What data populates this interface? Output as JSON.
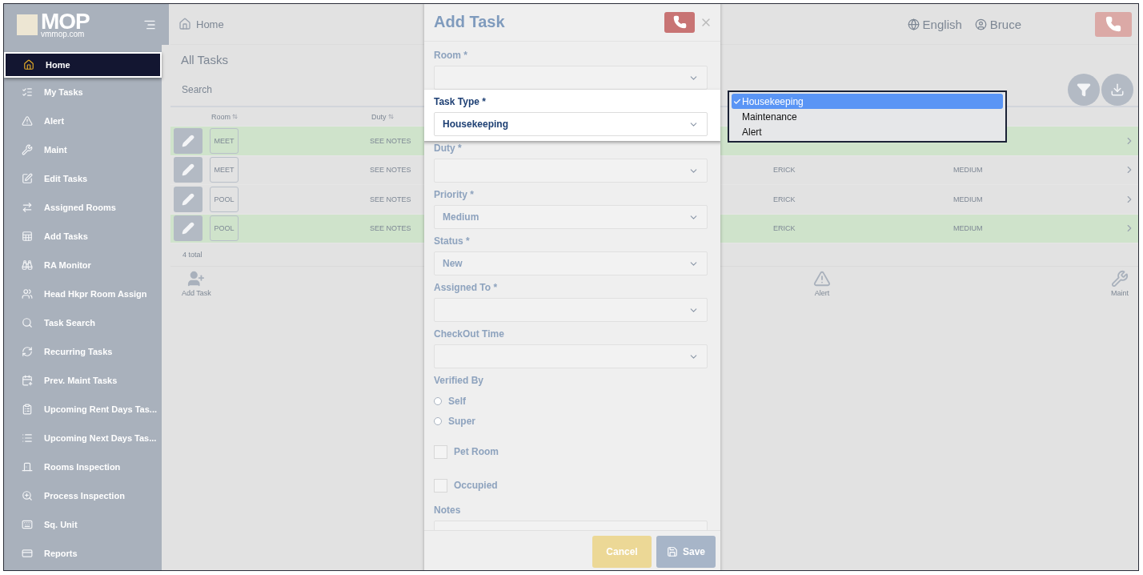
{
  "sidebar": {
    "logo": {
      "name": "MOP",
      "site": "vmmop.com"
    },
    "items": [
      {
        "label": "Home",
        "selected": true
      },
      {
        "label": "My Tasks",
        "selected": false
      },
      {
        "label": "Alert",
        "selected": false
      },
      {
        "label": "Maint",
        "selected": false
      },
      {
        "label": "Edit Tasks",
        "selected": false
      },
      {
        "label": "Assigned Rooms",
        "selected": false
      },
      {
        "label": "Add Tasks",
        "selected": false
      },
      {
        "label": "RA Monitor",
        "selected": false
      },
      {
        "label": "Head Hkpr Room Assign",
        "selected": false
      },
      {
        "label": "Task Search",
        "selected": false
      },
      {
        "label": "Recurring Tasks",
        "selected": false
      },
      {
        "label": "Prev. Maint Tasks",
        "selected": false
      },
      {
        "label": "Upcoming Rent Days Tas...",
        "selected": false
      },
      {
        "label": "Upcoming Next Days Tas...",
        "selected": false
      },
      {
        "label": "Rooms Inspection",
        "selected": false
      },
      {
        "label": "Process Inspection",
        "selected": false
      },
      {
        "label": "Sq. Unit",
        "selected": false
      },
      {
        "label": "Reports",
        "selected": false
      }
    ]
  },
  "header": {
    "breadcrumb": "Home",
    "language": "English",
    "user": "Bruce"
  },
  "page": {
    "title": "All Tasks",
    "search": {
      "placeholder": "Search"
    },
    "table": {
      "columns": [
        "Room",
        "Duty"
      ],
      "rows": [
        {
          "room": "MEET",
          "duty": "SEE NOTES",
          "highlighted": true
        },
        {
          "room": "MEET",
          "duty": "SEE NOTES",
          "assignee": "ERICK",
          "priority": "MEDIUM",
          "highlighted": false
        },
        {
          "room": "POOL",
          "duty": "SEE NOTES",
          "assignee": "ERICK",
          "priority": "MEDIUM",
          "highlighted": false
        },
        {
          "room": "POOL",
          "duty": "SEE NOTES",
          "assignee": "ERICK",
          "priority": "MEDIUM",
          "highlighted": true
        }
      ],
      "footer": "4 total"
    },
    "actions": [
      {
        "label": "Add Task"
      },
      {
        "label": "Alert"
      },
      {
        "label": "Maint"
      }
    ]
  },
  "modal": {
    "title": "Add Task",
    "fields": [
      {
        "kind": "select",
        "label": "Room *",
        "highlighted": false
      },
      {
        "kind": "select",
        "label": "Task Type *",
        "value": "Housekeeping",
        "highlighted": true
      },
      {
        "kind": "select",
        "label": "Duty *",
        "highlighted": false
      },
      {
        "kind": "select",
        "label": "Priority *",
        "value": "Medium",
        "highlighted": false
      },
      {
        "kind": "select",
        "label": "Status *",
        "value": "New",
        "highlighted": false
      },
      {
        "kind": "select",
        "label": "Assigned To *",
        "highlighted": false
      },
      {
        "kind": "select",
        "label": "CheckOut Time",
        "highlighted": false
      },
      {
        "kind": "radio",
        "label": "Verified By",
        "options": [
          {
            "label": "Self",
            "selected": false
          },
          {
            "label": "Super",
            "selected": false
          }
        ]
      },
      {
        "kind": "checkbox",
        "label": "Pet Room",
        "checked": false
      },
      {
        "kind": "checkbox",
        "label": "Occupied",
        "checked": false
      },
      {
        "kind": "textarea",
        "label": "Notes"
      }
    ],
    "buttons": [
      {
        "label": "Cancel",
        "kind": "cancel"
      },
      {
        "label": "Save",
        "kind": "save"
      }
    ]
  },
  "dropdown": {
    "options": [
      {
        "label": "Housekeeping",
        "selected": true
      },
      {
        "label": "Maintenance",
        "selected": false
      },
      {
        "label": "Alert",
        "selected": false
      }
    ]
  }
}
